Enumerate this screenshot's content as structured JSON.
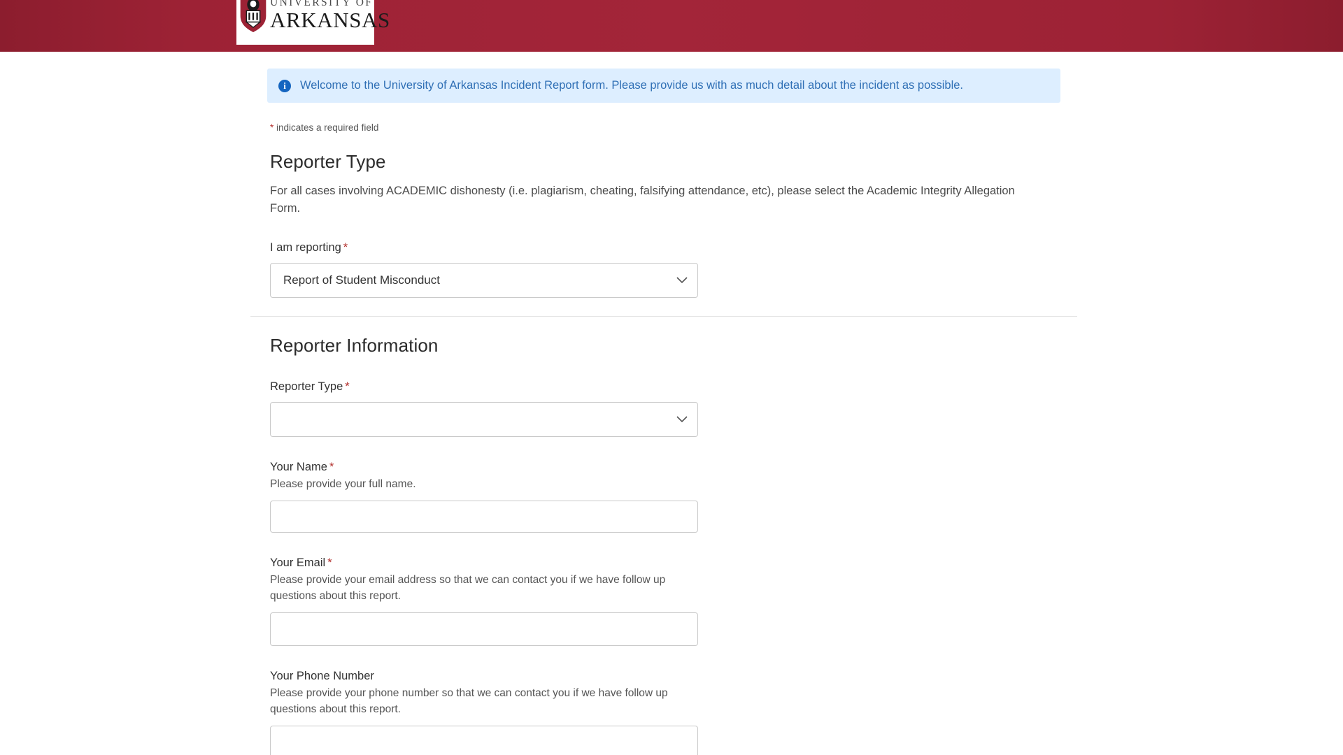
{
  "header": {
    "logo": {
      "line1": "UNIVERSITY OF",
      "line2": "ARKANSAS",
      "shield_icon": "razorback-shield-icon"
    },
    "menu_icon": "kebab-menu-icon",
    "bar_color": "#9d2235"
  },
  "banner": {
    "icon": "info-circle-icon",
    "text": "Welcome to the University of Arkansas Incident Report form. Please provide us with as much detail about the incident as possible.",
    "background_color": "#ddeeff",
    "text_color": "#2f6fb5"
  },
  "required_note": {
    "star": "*",
    "text": " indicates a required field",
    "star_color": "#b3322f"
  },
  "sections": [
    {
      "title": "Reporter Type",
      "description": "For all cases involving ACADEMIC dishonesty (i.e. plagiarism, cheating, falsifying attendance, etc), please select the Academic Integrity Allegation Form.",
      "fields": [
        {
          "label": "I am reporting",
          "required": "*",
          "help": "",
          "type": "select",
          "value": "Report of Student Misconduct",
          "icon": "chevron-down-icon"
        }
      ]
    },
    {
      "title": "Reporter Information",
      "description": "",
      "fields": [
        {
          "label": "Reporter Type",
          "required": "*",
          "help": "",
          "type": "select",
          "value": "",
          "icon": "chevron-down-icon"
        },
        {
          "label": "Your Name",
          "required": "*",
          "help": "Please provide your full name.",
          "type": "text",
          "value": ""
        },
        {
          "label": "Your Email",
          "required": "*",
          "help": "Please provide your email address so that we can contact you if we have follow up questions about this report.",
          "type": "text",
          "value": ""
        },
        {
          "label": "Your Phone Number",
          "required": "",
          "help": "Please provide your phone number so that we can contact you if we have follow up questions about this report.",
          "type": "text",
          "value": ""
        }
      ]
    }
  ]
}
